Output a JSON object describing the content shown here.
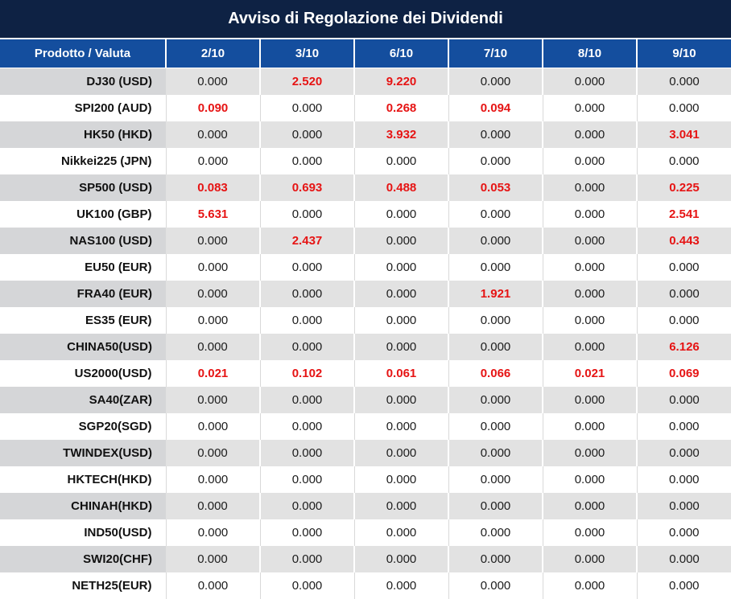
{
  "title": "Avviso di Regolazione dei Dividendi",
  "colors": {
    "title_bg": "#0e2244",
    "header_bg": "#144e9e",
    "header_text": "#ffffff",
    "row_alt_bg": "#e2e2e2",
    "row_alt_product_bg": "#d5d6d8",
    "row_bg": "#ffffff",
    "value_text": "#1c1c1c",
    "highlight_red": "#e61414"
  },
  "chart_data": {
    "type": "table",
    "title": "Avviso di Regolazione dei Dividendi",
    "product_header": "Prodotto / Valuta",
    "date_columns": [
      "2/10",
      "3/10",
      "6/10",
      "7/10",
      "8/10",
      "9/10"
    ],
    "zero_value": "0.000",
    "rows": [
      {
        "product": "DJ30 (USD)",
        "values": [
          "0.000",
          "2.520",
          "9.220",
          "0.000",
          "0.000",
          "0.000"
        ]
      },
      {
        "product": "SPI200 (AUD)",
        "values": [
          "0.090",
          "0.000",
          "0.268",
          "0.094",
          "0.000",
          "0.000"
        ]
      },
      {
        "product": "HK50 (HKD)",
        "values": [
          "0.000",
          "0.000",
          "3.932",
          "0.000",
          "0.000",
          "3.041"
        ]
      },
      {
        "product": "Nikkei225 (JPN)",
        "values": [
          "0.000",
          "0.000",
          "0.000",
          "0.000",
          "0.000",
          "0.000"
        ]
      },
      {
        "product": "SP500 (USD)",
        "values": [
          "0.083",
          "0.693",
          "0.488",
          "0.053",
          "0.000",
          "0.225"
        ]
      },
      {
        "product": "UK100 (GBP)",
        "values": [
          "5.631",
          "0.000",
          "0.000",
          "0.000",
          "0.000",
          "2.541"
        ]
      },
      {
        "product": "NAS100 (USD)",
        "values": [
          "0.000",
          "2.437",
          "0.000",
          "0.000",
          "0.000",
          "0.443"
        ]
      },
      {
        "product": "EU50 (EUR)",
        "values": [
          "0.000",
          "0.000",
          "0.000",
          "0.000",
          "0.000",
          "0.000"
        ]
      },
      {
        "product": "FRA40 (EUR)",
        "values": [
          "0.000",
          "0.000",
          "0.000",
          "1.921",
          "0.000",
          "0.000"
        ]
      },
      {
        "product": "ES35 (EUR)",
        "values": [
          "0.000",
          "0.000",
          "0.000",
          "0.000",
          "0.000",
          "0.000"
        ]
      },
      {
        "product": "CHINA50(USD)",
        "values": [
          "0.000",
          "0.000",
          "0.000",
          "0.000",
          "0.000",
          "6.126"
        ]
      },
      {
        "product": "US2000(USD)",
        "values": [
          "0.021",
          "0.102",
          "0.061",
          "0.066",
          "0.021",
          "0.069"
        ]
      },
      {
        "product": "SA40(ZAR)",
        "values": [
          "0.000",
          "0.000",
          "0.000",
          "0.000",
          "0.000",
          "0.000"
        ]
      },
      {
        "product": "SGP20(SGD)",
        "values": [
          "0.000",
          "0.000",
          "0.000",
          "0.000",
          "0.000",
          "0.000"
        ]
      },
      {
        "product": "TWINDEX(USD)",
        "values": [
          "0.000",
          "0.000",
          "0.000",
          "0.000",
          "0.000",
          "0.000"
        ]
      },
      {
        "product": "HKTECH(HKD)",
        "values": [
          "0.000",
          "0.000",
          "0.000",
          "0.000",
          "0.000",
          "0.000"
        ]
      },
      {
        "product": "CHINAH(HKD)",
        "values": [
          "0.000",
          "0.000",
          "0.000",
          "0.000",
          "0.000",
          "0.000"
        ]
      },
      {
        "product": "IND50(USD)",
        "values": [
          "0.000",
          "0.000",
          "0.000",
          "0.000",
          "0.000",
          "0.000"
        ]
      },
      {
        "product": "SWI20(CHF)",
        "values": [
          "0.000",
          "0.000",
          "0.000",
          "0.000",
          "0.000",
          "0.000"
        ]
      },
      {
        "product": "NETH25(EUR)",
        "values": [
          "0.000",
          "0.000",
          "0.000",
          "0.000",
          "0.000",
          "0.000"
        ]
      }
    ]
  }
}
